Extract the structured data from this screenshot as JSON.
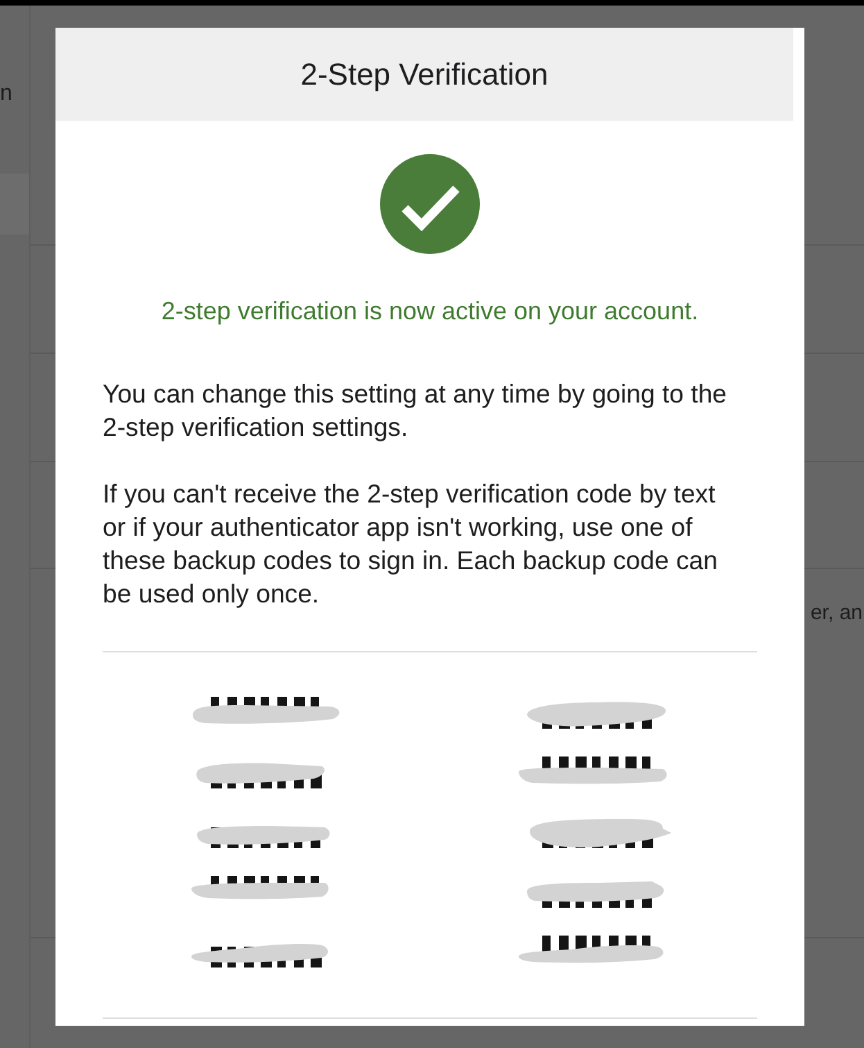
{
  "background": {
    "sidebar": {
      "text": "n"
    },
    "content": {
      "text": "er, an"
    }
  },
  "dialog": {
    "title": "2-Step Verification",
    "status_message": "2-step verification is now active on your account.",
    "paragraphs": [
      "You can change this setting at any time by going to the 2-step verification settings.",
      "If you can't receive the 2-step verification code by text or if your authenticator app isn't working, use one of these backup codes to sign in. Each backup code can be used only once."
    ],
    "backup_codes": [
      {
        "kind": "redacted"
      },
      {
        "kind": "redacted"
      },
      {
        "kind": "redacted"
      },
      {
        "kind": "redacted"
      },
      {
        "kind": "redacted"
      },
      {
        "kind": "redacted"
      },
      {
        "kind": "redacted"
      },
      {
        "kind": "redacted"
      },
      {
        "kind": "redacted"
      },
      {
        "kind": "redacted"
      }
    ]
  }
}
